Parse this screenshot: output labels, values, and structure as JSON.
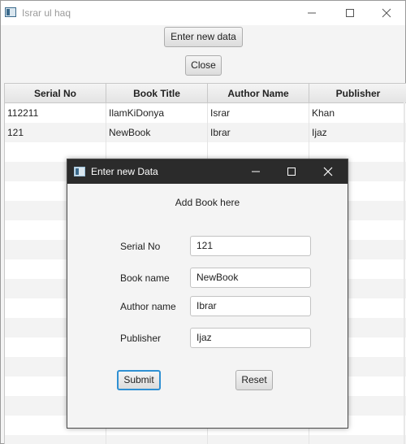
{
  "window": {
    "title": "Israr ul haq",
    "minimize_icon": "minimize-icon",
    "maximize_icon": "maximize-icon",
    "close_icon": "close-icon"
  },
  "toolbar": {
    "enter_label": "Enter new data",
    "close_label": "Close"
  },
  "table": {
    "columns": [
      "Serial No",
      "Book Title",
      "Author Name",
      "Publisher"
    ],
    "rows": [
      [
        "112211",
        "IlamKiDonya",
        "Israr",
        "Khan"
      ],
      [
        "121",
        "NewBook",
        "Ibrar",
        "Ijaz"
      ]
    ]
  },
  "dialog": {
    "title": "Enter new Data",
    "heading": "Add Book here",
    "fields": [
      {
        "label": "Serial No",
        "value": "121"
      },
      {
        "label": "Book name",
        "value": "NewBook"
      },
      {
        "label": "Author name",
        "value": "Ibrar"
      },
      {
        "label": "Publisher",
        "value": "Ijaz"
      }
    ],
    "submit_label": "Submit",
    "reset_label": "Reset"
  }
}
